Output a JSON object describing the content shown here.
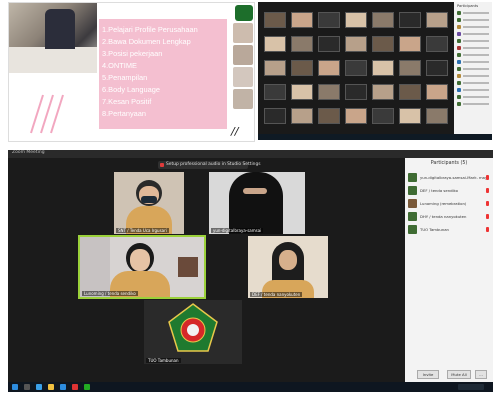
{
  "slide": {
    "items": [
      "1.Pelajari Profile Perusahaan",
      "2.Bawa Dokumen Lengkap",
      "3.Posisi pekerjaan",
      "4.ONTIME",
      "5.Penampilan",
      "6.Body Language",
      "7.Kesan Positif",
      "8.Pertanyaan"
    ],
    "pink": "#f4bfd0"
  },
  "gallery": {
    "panel_title": "Participants"
  },
  "meeting": {
    "window_title": "Zoom Meeting",
    "banner_text": "Setup professional audio in Studio Settings",
    "participants_title": "Participants (5)",
    "participants": [
      "yun-digitalbraya-samsai-Mark. may",
      "DEF / tenda sendiko",
      "Lunoming (remebration)",
      "DHY / tenda nanyokuten",
      "TUO Tambunan"
    ],
    "tiles": [
      {
        "name": "SNT / Tenda Uca Irgusari"
      },
      {
        "name": "yun-digitalbraya-samsai"
      },
      {
        "name": "Lunoming / tenda sendiko"
      },
      {
        "name": "DEF / tenda nanyokuten"
      },
      {
        "name": "TUO Tambunan"
      }
    ],
    "buttons": [
      "Invite",
      "Mute All",
      "..."
    ],
    "accent": "#9bd13a"
  }
}
